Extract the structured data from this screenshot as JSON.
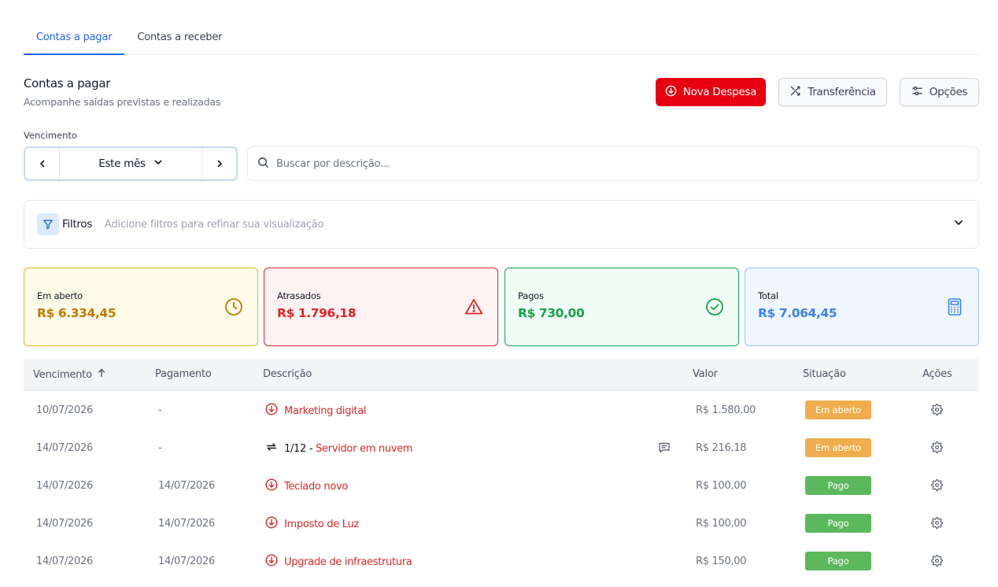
{
  "tabs": [
    {
      "label": "Contas a pagar",
      "active": true
    },
    {
      "label": "Contas a receber",
      "active": false
    }
  ],
  "header": {
    "title": "Contas a pagar",
    "subtitle": "Acompanhe saídas previstas e realizadas"
  },
  "actions": {
    "new_expense": "Nova Despesa",
    "transfer": "Transferência",
    "options": "Opções"
  },
  "due_filter": {
    "label": "Vencimento",
    "period": "Este mês"
  },
  "search": {
    "placeholder": "Buscar por descrição..."
  },
  "filters": {
    "title": "Filtros",
    "hint": "Adicione filtros para refinar sua visualização"
  },
  "summary": {
    "open": {
      "label": "Em aberto",
      "value": "R$ 6.334,45",
      "color": "#c07a00"
    },
    "late": {
      "label": "Atrasados",
      "value": "R$ 1.796,18",
      "color": "#dc2626"
    },
    "paid": {
      "label": "Pagos",
      "value": "R$ 730,00",
      "color": "#16a34a"
    },
    "total": {
      "label": "Total",
      "value": "R$ 7.064,45",
      "color": "#3b82f6"
    }
  },
  "table": {
    "columns": {
      "due": "Vencimento",
      "payment": "Pagamento",
      "description": "Descrição",
      "value": "Valor",
      "status": "Situação",
      "actions": "Ações"
    },
    "rows": [
      {
        "due": "10/07/2026",
        "payment": "-",
        "icon": "arrow-down-circle-icon",
        "installment": "",
        "description": "Marketing digital",
        "has_comment": false,
        "value": "R$ 1.580,00",
        "status": "Em aberto",
        "status_color": "#f0ad4e"
      },
      {
        "due": "14/07/2026",
        "payment": "-",
        "icon": "recurring-icon",
        "installment": "1/12 - ",
        "description": "Servidor em nuvem",
        "has_comment": true,
        "value": "R$ 216,18",
        "status": "Em aberto",
        "status_color": "#f0ad4e"
      },
      {
        "due": "14/07/2026",
        "payment": "14/07/2026",
        "icon": "arrow-down-circle-icon",
        "installment": "",
        "description": "Teclado novo",
        "has_comment": false,
        "value": "R$ 100,00",
        "status": "Pago",
        "status_color": "#5cb85c"
      },
      {
        "due": "14/07/2026",
        "payment": "14/07/2026",
        "icon": "arrow-down-circle-icon",
        "installment": "",
        "description": "Imposto de Luz",
        "has_comment": false,
        "value": "R$ 100,00",
        "status": "Pago",
        "status_color": "#5cb85c"
      },
      {
        "due": "14/07/2026",
        "payment": "14/07/2026",
        "icon": "arrow-down-circle-icon",
        "installment": "",
        "description": "Upgrade de infraestrutura",
        "has_comment": false,
        "value": "R$ 150,00",
        "status": "Pago",
        "status_color": "#5cb85c"
      }
    ]
  }
}
